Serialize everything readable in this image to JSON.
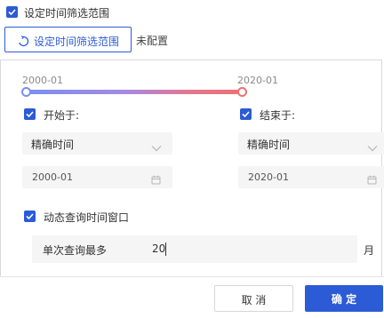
{
  "header": {
    "checkbox_checked": true,
    "label": "设定时间筛选范围"
  },
  "tab": {
    "active_label": "设定时间筛选范围",
    "icon": "refresh-icon",
    "secondary_label": "未配置"
  },
  "slider": {
    "min_label": "2000-01",
    "max_label": "2020-01",
    "colors": {
      "start": "#7b8ff0",
      "end": "#ee6f72"
    }
  },
  "start": {
    "checkbox_checked": true,
    "label": "开始于:",
    "mode": "精确时间",
    "date": "2000-01"
  },
  "end": {
    "checkbox_checked": true,
    "label": "结束于:",
    "mode": "精确时间",
    "date": "2020-01"
  },
  "dynamic": {
    "checkbox_checked": true,
    "label": "动态查询时间窗口",
    "max_label": "单次查询最多",
    "value": "20",
    "unit": "月"
  },
  "footer": {
    "cancel": "取 消",
    "confirm": "确 定"
  },
  "colors": {
    "accent": "#2c5bd6"
  }
}
